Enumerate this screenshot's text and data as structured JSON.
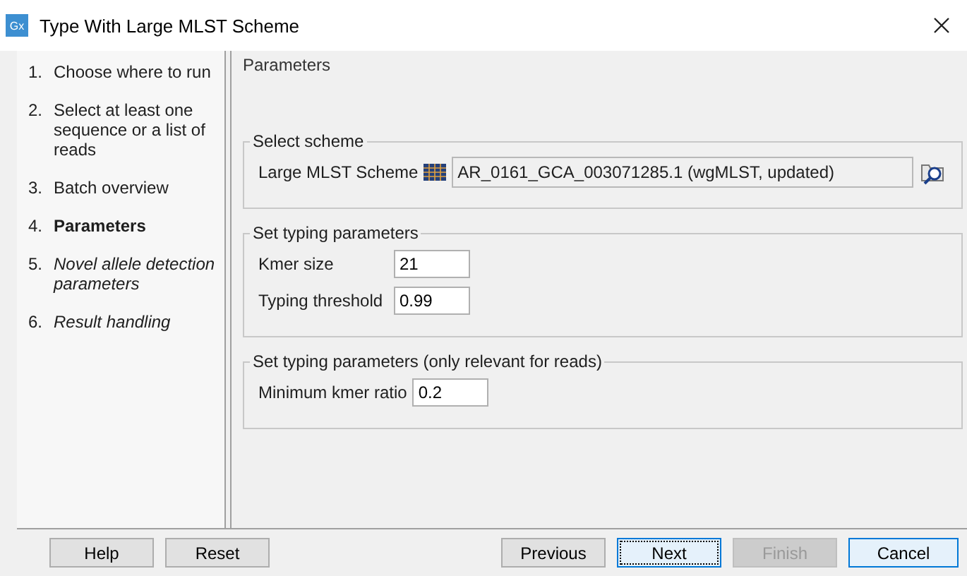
{
  "window": {
    "title": "Type With Large MLST Scheme",
    "app_icon": "Gx"
  },
  "steps": [
    {
      "number": "1.",
      "label": "Choose where to run",
      "selected": false,
      "italic": false
    },
    {
      "number": "2.",
      "label": "Select at least one sequence or a list of reads",
      "selected": false,
      "italic": false
    },
    {
      "number": "3.",
      "label": "Batch overview",
      "selected": false,
      "italic": false
    },
    {
      "number": "4.",
      "label": "Parameters",
      "selected": true,
      "italic": false
    },
    {
      "number": "5.",
      "label": "Novel allele detection parameters",
      "selected": false,
      "italic": true
    },
    {
      "number": "6.",
      "label": "Result handling",
      "selected": false,
      "italic": true
    }
  ],
  "panel": {
    "title": "Parameters"
  },
  "groups": [
    {
      "title": "Select scheme",
      "fields": [
        {
          "kind": "scheme",
          "label": "Large MLST Scheme",
          "value": "AR_0161_GCA_003071285.1 (wgMLST, updated)"
        }
      ]
    },
    {
      "title": "Set typing parameters",
      "fields": [
        {
          "kind": "text",
          "label": "Kmer size",
          "value": "21"
        },
        {
          "kind": "text",
          "label": "Typing threshold",
          "value": "0.99"
        }
      ]
    },
    {
      "title": "Set typing parameters (only relevant for reads)",
      "fields": [
        {
          "kind": "text",
          "label": "Minimum kmer ratio",
          "value": "0.2"
        }
      ]
    }
  ],
  "buttons": [
    {
      "label": "Help",
      "kind": "utility",
      "disabled": false,
      "focused": false
    },
    {
      "label": "Reset",
      "kind": "utility",
      "disabled": false,
      "focused": false
    },
    {
      "label": "Previous",
      "kind": "navigation",
      "disabled": false,
      "focused": false
    },
    {
      "label": "Next",
      "kind": "navigation",
      "disabled": false,
      "focused": true
    },
    {
      "label": "Finish",
      "kind": "navigation",
      "disabled": true,
      "focused": false
    },
    {
      "label": "Cancel",
      "kind": "navigation",
      "disabled": false,
      "focused": false
    }
  ]
}
